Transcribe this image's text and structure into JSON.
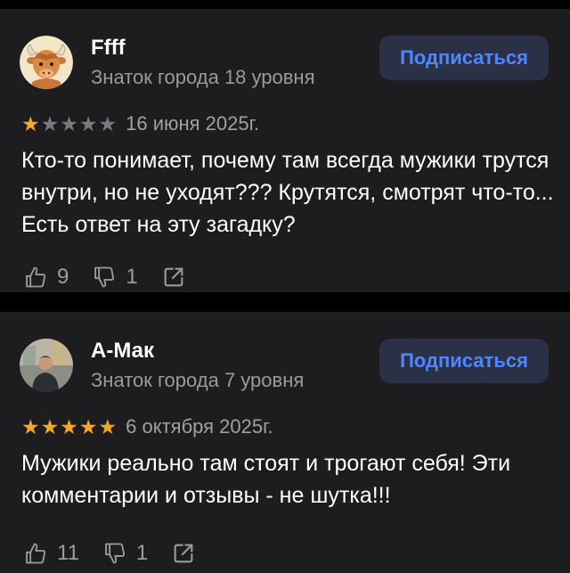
{
  "reviews": [
    {
      "author": "Ffff",
      "level": "Знаток города 18 уровня",
      "subscribe_label": "Подписаться",
      "rating": 1,
      "date": "16 июня 2025г.",
      "text": "Кто-то понимает, почему там всегда мужики трутся внутри, но не уходят??? Крутятся, смотрят что-то... Есть ответ на эту загадку?",
      "likes": "9",
      "dislikes": "1",
      "avatar": "yak-cartoon-avatar"
    },
    {
      "author": "А-Мак",
      "level": "Знаток города 7 уровня",
      "subscribe_label": "Подписаться",
      "rating": 5,
      "date": "6 октября 2025г.",
      "text": "Мужики реально там стоят и трогают себя! Эти комментарии и отзывы - не шутка!!!",
      "likes": "11",
      "dislikes": "1",
      "avatar": "person-photo-avatar"
    }
  ],
  "colors": {
    "background": "#000000",
    "card": "#1d1d1f",
    "accent": "#4f86ff",
    "button_bg": "#2a3147",
    "star_on": "#f5a623",
    "star_off": "#7b7b80",
    "muted_text": "#9a9a9f"
  }
}
